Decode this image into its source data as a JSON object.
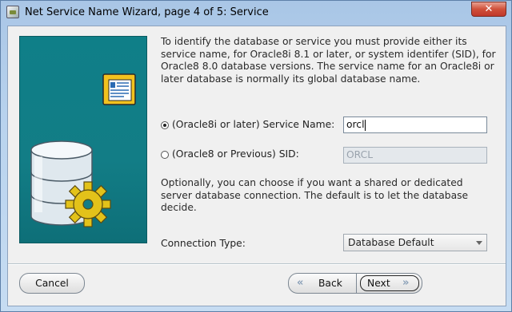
{
  "window": {
    "title": "Net Service Name Wizard, page 4 of 5: Service",
    "close_glyph": "✕"
  },
  "intro": "To identify the database or service you must provide either its service name, for Oracle8i 8.1 or later, or system identifer (SID), for Oracle8 8.0 database versions. The service name for an Oracle8i or later database is normally its global database name.",
  "options": {
    "service_name": {
      "label": "(Oracle8i or later)  Service Name:",
      "value": "orcl",
      "selected": true
    },
    "sid": {
      "label": "(Oracle8 or Previous) SID:",
      "value": "ORCL",
      "selected": false
    }
  },
  "connection_note": "Optionally, you can choose if you want a shared or dedicated server database connection. The default is to let the database decide.",
  "connection_type": {
    "label": "Connection Type:",
    "value": "Database Default"
  },
  "buttons": {
    "cancel": "Cancel",
    "back": "Back",
    "next": "Next"
  },
  "icons": {
    "illustration": [
      "document-icon",
      "database-icon",
      "gear-icon"
    ],
    "nav": [
      "chevron-left-icon",
      "chevron-right-icon"
    ]
  },
  "colors": {
    "illustration_bg": "#127d86",
    "gear": "#e3c21a",
    "database": "#dfe8ee"
  }
}
